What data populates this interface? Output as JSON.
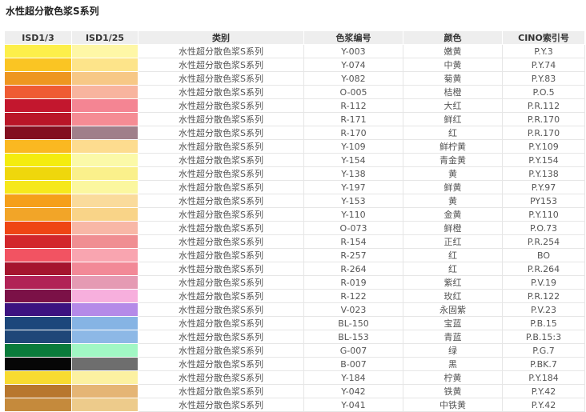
{
  "title": "水性超分散色浆S系列",
  "headers": {
    "isd13": "ISD1/3",
    "isd125": "ISD1/25",
    "category": "类别",
    "code": "色浆编号",
    "color": "颜色",
    "cino": "CINO索引号"
  },
  "rows": [
    {
      "c1": "#FDEF4A",
      "c2": "#FEF7A6",
      "category": "水性超分散色浆S系列",
      "code": "Y-003",
      "color": "嫩黄",
      "cino": "P.Y.3"
    },
    {
      "c1": "#FAC523",
      "c2": "#FDE48A",
      "category": "水性超分散色浆S系列",
      "code": "Y-074",
      "color": "中黄",
      "cino": "P.Y.74"
    },
    {
      "c1": "#EE9620",
      "c2": "#F7C886",
      "category": "水性超分散色浆S系列",
      "code": "Y-082",
      "color": "菊黄",
      "cino": "P.Y.83"
    },
    {
      "c1": "#EF5B33",
      "c2": "#F8B49E",
      "category": "水性超分散色浆S系列",
      "code": "O-005",
      "color": "桔橙",
      "cino": "P.O.5"
    },
    {
      "c1": "#C3172E",
      "c2": "#F48593",
      "category": "水性超分散色浆S系列",
      "code": "R-112",
      "color": "大红",
      "cino": "P.R.112"
    },
    {
      "c1": "#BA1628",
      "c2": "#F58C94",
      "category": "水性超分散色浆S系列",
      "code": "R-171",
      "color": "鲜红",
      "cino": "P.R.170"
    },
    {
      "c1": "#830F20",
      "c2": "#A07F8A",
      "category": "水性超分散色浆S系列",
      "code": "R-170",
      "color": "红",
      "cino": "P.R.170"
    },
    {
      "c1": "#FAB821",
      "c2": "#FDDC8F",
      "category": "水性超分散色浆S系列",
      "code": "Y-109",
      "color": "鲜柠黄",
      "cino": "P.Y.109"
    },
    {
      "c1": "#F4EC0E",
      "c2": "#FBF9A8",
      "category": "水性超分散色浆S系列",
      "code": "Y-154",
      "color": "青金黄",
      "cino": "P.Y.154"
    },
    {
      "c1": "#EFD70C",
      "c2": "#FAF08B",
      "category": "水性超分散色浆S系列",
      "code": "Y-138",
      "color": "黄",
      "cino": "P.Y.138"
    },
    {
      "c1": "#F6E81B",
      "c2": "#FBF79F",
      "category": "水性超分散色浆S系列",
      "code": "Y-197",
      "color": "鲜黄",
      "cino": "P.Y.97"
    },
    {
      "c1": "#F59F19",
      "c2": "#FADB9B",
      "category": "水性超分散色浆S系列",
      "code": "Y-153",
      "color": "黄",
      "cino": "PY153"
    },
    {
      "c1": "#F2A528",
      "c2": "#F9D488",
      "category": "水性超分散色浆S系列",
      "code": "Y-110",
      "color": "金黄",
      "cino": "P.Y.110"
    },
    {
      "c1": "#EF4514",
      "c2": "#F8B7A6",
      "category": "水性超分散色浆S系列",
      "code": "O-073",
      "color": "鲜橙",
      "cino": "P.O.73"
    },
    {
      "c1": "#D2262C",
      "c2": "#F08E92",
      "category": "水性超分散色浆S系列",
      "code": "R-154",
      "color": "正红",
      "cino": "P.R.254"
    },
    {
      "c1": "#F25362",
      "c2": "#F9A5B0",
      "category": "水性超分散色浆S系列",
      "code": "R-257",
      "color": "红",
      "cino": "BO"
    },
    {
      "c1": "#A5152E",
      "c2": "#F28997",
      "category": "水性超分散色浆S系列",
      "code": "R-264",
      "color": "红",
      "cino": "P.R.264"
    },
    {
      "c1": "#B12256",
      "c2": "#E59AB3",
      "category": "水性超分散色浆S系列",
      "code": "R-019",
      "color": "紫红",
      "cino": "P.V.19"
    },
    {
      "c1": "#7B1147",
      "c2": "#F7AFDD",
      "category": "水性超分散色浆S系列",
      "code": "R-122",
      "color": "玫红",
      "cino": "P.R.122"
    },
    {
      "c1": "#3C1380",
      "c2": "#B58AE8",
      "category": "水性超分散色浆S系列",
      "code": "V-023",
      "color": "永固紫",
      "cino": "P.V.23"
    },
    {
      "c1": "#1C477B",
      "c2": "#86B4E4",
      "category": "水性超分散色浆S系列",
      "code": "BL-150",
      "color": "宝蓝",
      "cino": "P.B.15"
    },
    {
      "c1": "#1F4778",
      "c2": "#8DB8E6",
      "category": "水性超分散色浆S系列",
      "code": "BL-153",
      "color": "青蓝",
      "cino": "P.B.15:3"
    },
    {
      "c1": "#0A7B3B",
      "c2": "#A1F7C4",
      "category": "水性超分散色浆S系列",
      "code": "G-007",
      "color": "绿",
      "cino": "P.G.7"
    },
    {
      "c1": "#060606",
      "c2": "#6E6E6E",
      "category": "水性超分散色浆S系列",
      "code": "B-007",
      "color": "黑",
      "cino": "P.BK.7"
    },
    {
      "c1": "#F8DB31",
      "c2": "#FCF1A1",
      "category": "水性超分散色浆S系列",
      "code": "Y-184",
      "color": "柠黄",
      "cino": "P.Y.184"
    },
    {
      "c1": "#B8772E",
      "c2": "#E5B575",
      "category": "水性超分散色浆S系列",
      "code": "Y-042",
      "color": "铁黄",
      "cino": "P.Y.42"
    },
    {
      "c1": "#C58A3C",
      "c2": "#EDCB8B",
      "category": "水性超分散色浆S系列",
      "code": "Y-041",
      "color": "中铁黄",
      "cino": "P.Y.42"
    }
  ]
}
